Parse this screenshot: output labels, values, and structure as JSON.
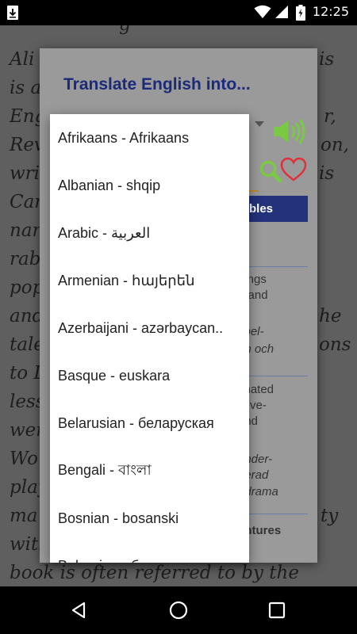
{
  "status_bar": {
    "time": "12:25",
    "icons": [
      "download-arrow-icon",
      "wifi-icon",
      "cellular-signal-icon",
      "battery-charging-icon"
    ]
  },
  "background_page": {
    "lines": [
      "Ali",
      "is a w",
      "Eng",
      "Rev",
      "writ",
      "Car",
      "nar",
      "rab",
      "pop",
      "and",
      "tale",
      "to L",
      "less",
      "wer",
      "Wo",
      "play",
      "ma",
      "with",
      "book is often referred to by the"
    ],
    "right_fragments": [
      "is",
      "r,",
      "on,",
      "is",
      "he",
      "ons",
      "ty"
    ],
    "top_fragment": "g"
  },
  "dialog": {
    "title": "Translate English into...",
    "examples_label": "bles",
    "text_fragments": [
      {
        "text": "dings",
        "italic": false
      },
      {
        "text": "n and",
        "italic": false
      },
      {
        "text": "spel-",
        "italic": true
      },
      {
        "text": "on och",
        "italic": true
      },
      {
        "text": "imated",
        "italic": false
      },
      {
        "text": ", live-",
        "italic": false
      },
      {
        "text": "and",
        "italic": false
      },
      {
        "text": "under-",
        "italic": true
      },
      {
        "text": "nerad",
        "italic": true
      },
      {
        "text": ", drama",
        "italic": true
      }
    ],
    "adventures_label": "entures"
  },
  "languages": [
    "Afrikaans - Afrikaans",
    "Albanian - shqip",
    "Arabic - العربية",
    "Armenian - հայերեն",
    "Azerbaijani - azərbaycan..",
    "Basque - euskara",
    "Belarusian - беларуская",
    "Bengali - বাংলা",
    "Bosnian - bosanski",
    "Bulgarian - български"
  ],
  "colors": {
    "title": "#1c2a7a",
    "examples_button": "#23327a",
    "speaker": "#7ac943",
    "heart": "#e0303a",
    "search": "#7ac943"
  },
  "nav_bar": {
    "buttons": [
      "back-icon",
      "home-icon",
      "recents-icon"
    ]
  }
}
